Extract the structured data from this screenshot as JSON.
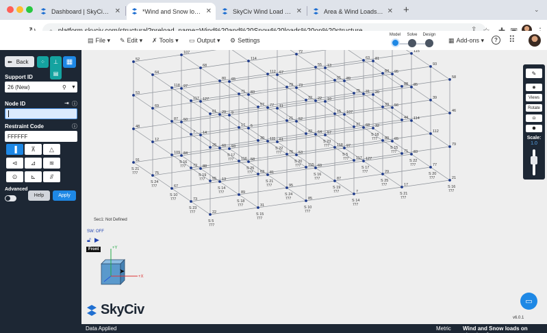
{
  "browser": {
    "tabs": [
      {
        "title": "Dashboard | SkyCiv Platform",
        "active": false
      },
      {
        "title": "*Wind and Snow loads on structu",
        "active": true
      },
      {
        "title": "SkyCiv Wind Load Generator | Sk",
        "active": false
      },
      {
        "title": "Area & Wind Loads | SkyCiv En",
        "active": false
      }
    ],
    "new_tab": "+",
    "url": "platform.skyciv.com/structural?preload_name=Wind%20and%20Snow%20loads%20on%20structure"
  },
  "toolbar": {
    "menus": [
      "File",
      "Edit",
      "Tools",
      "Output",
      "Settings"
    ],
    "stages": [
      "Model",
      "Solve",
      "Design"
    ],
    "active_stage": "Model",
    "addons": "Add-ons"
  },
  "sidebar": {
    "back": "Back",
    "support_id_label": "Support ID",
    "support_id_value": "26 (New)",
    "node_id_label": "Node ID",
    "node_id_value": "",
    "restraint_label": "Restraint Code",
    "restraint_value": "FFFFFF",
    "advanced_label": "Advanced",
    "help": "Help",
    "apply": "Apply"
  },
  "canvas": {
    "sec_label": "Sec1: Not Defined",
    "sw_label": "SW: OFF",
    "view_label": "Front",
    "logo_text": "SkyCiv",
    "version": "v6.0.1",
    "scale_label": "Scale:",
    "scale_value": "1.0",
    "right_tools": [
      "Views",
      "Rotate"
    ],
    "axis": {
      "y": "+Y",
      "x": "+X"
    },
    "node_labels": [
      "52",
      "107",
      "56",
      "109",
      "60",
      "111",
      "64",
      "68",
      "114",
      "72",
      "116",
      "76",
      "118",
      "80",
      "112",
      "55",
      "63",
      "115",
      "117",
      "71",
      "79",
      "91",
      "84",
      "93",
      "61",
      "57",
      "32",
      "75",
      "88",
      "58",
      "53",
      "97",
      "65",
      "67",
      "13",
      "81",
      "69",
      "127",
      "83",
      "73",
      "89",
      "95",
      "87",
      "29",
      "77",
      "22",
      "31",
      "85",
      "7",
      "17",
      "21",
      "15",
      "33",
      "39",
      "26",
      "30",
      "42",
      "37",
      "44",
      "46",
      "48",
      "50",
      "9",
      "11",
      "10",
      "20",
      "12",
      "14",
      "5"
    ],
    "support_tags": [
      "S 21",
      "S 16",
      "S 17",
      "S 22",
      "S 23",
      "S 18",
      "S 24",
      "S 19",
      "S 25",
      "S 20",
      "S 5",
      "S 15",
      "S 10",
      "S 14"
    ],
    "fixity": "777"
  },
  "status": {
    "left": "Data Applied",
    "units": "Metric",
    "file": "Wind and Snow loads on structure*"
  },
  "colors": {
    "brand": "#1d2734",
    "accent": "#1e88e5",
    "teal": "#14a3a0",
    "node": "#1e3a8a"
  }
}
